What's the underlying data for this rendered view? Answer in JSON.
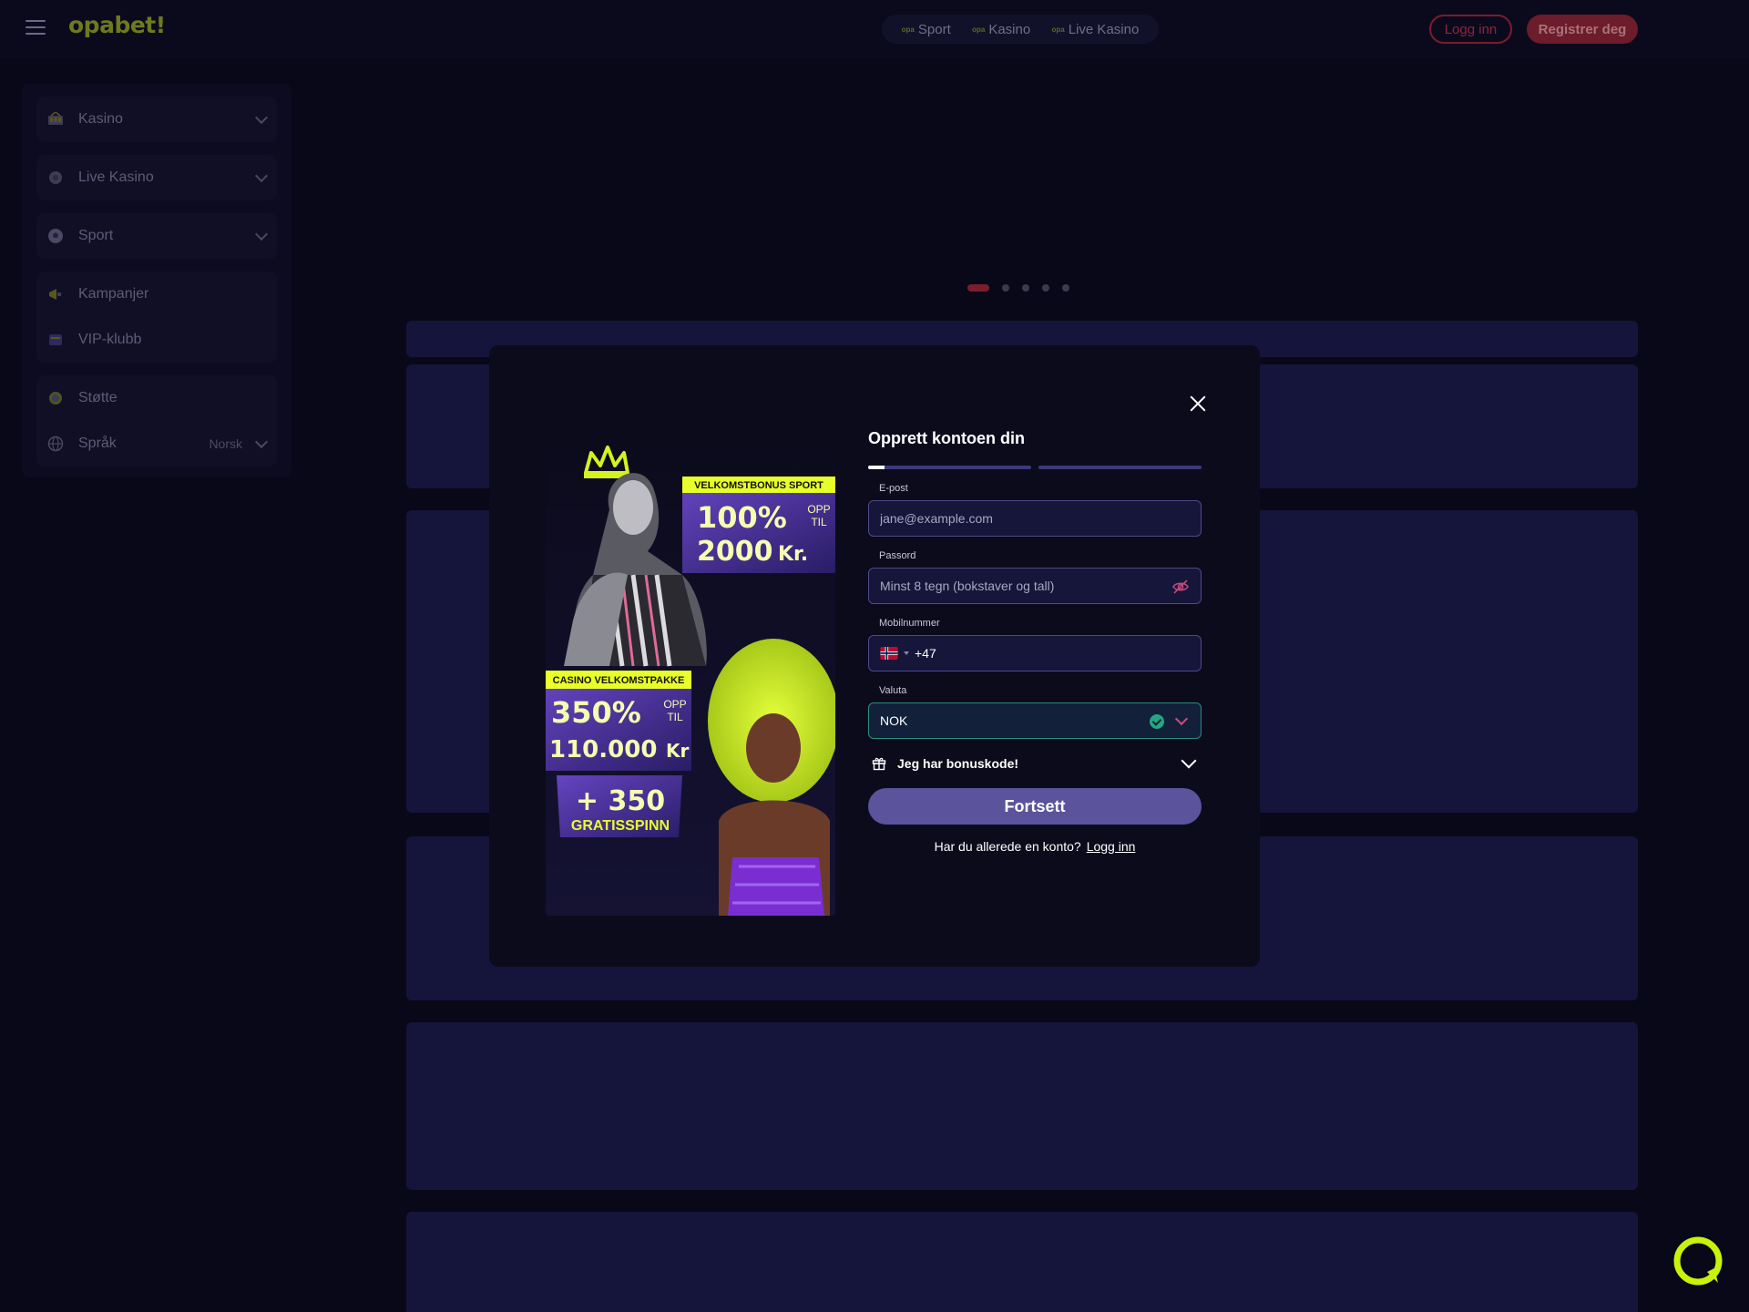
{
  "header": {
    "logo": "opabet!",
    "nav": [
      {
        "mini": "opa",
        "label": "Sport"
      },
      {
        "mini": "opa",
        "label": "Kasino"
      },
      {
        "mini": "opa",
        "label": "Live Kasino"
      }
    ],
    "login_label": "Logg inn",
    "register_label": "Registrer deg"
  },
  "sidebar": {
    "items": [
      {
        "label": "Kasino",
        "icon": "kasino-icon"
      },
      {
        "label": "Live Kasino",
        "icon": "live-kasino-icon"
      },
      {
        "label": "Sport",
        "icon": "sport-ball-icon"
      },
      {
        "label": "Kampanjer",
        "icon": "megaphone-icon"
      },
      {
        "label": "VIP-klubb",
        "icon": "vip-icon"
      },
      {
        "label": "Støtte",
        "icon": "support-icon"
      },
      {
        "label": "Språk",
        "icon": "globe-icon",
        "value": "Norsk"
      }
    ]
  },
  "carousel": {
    "slides": 5,
    "active": 1
  },
  "modal": {
    "title": "Opprett kontoen din",
    "progress": {
      "steps": 2,
      "step1_fill": 0.1
    },
    "promo": {
      "sport_badge": "VELKOMSTBONUS SPORT",
      "sport_pct": "100%",
      "sport_opp": "OPP",
      "sport_til": "TIL",
      "sport_amount": "2000",
      "sport_currency": "Kr.",
      "casino_badge": "CASINO VELKOMSTPAKKE",
      "casino_pct": "350%",
      "casino_opp": "OPP",
      "casino_til": "TIL",
      "casino_amount": "110.000",
      "casino_currency": "Kr",
      "spins_amount": "+ 350",
      "spins_label": "GRATISSPINN"
    },
    "email": {
      "label": "E-post",
      "placeholder": "jane@example.com"
    },
    "password": {
      "label": "Passord",
      "placeholder": "Minst 8 tegn (bokstaver og tall)"
    },
    "phone": {
      "label": "Mobilnummer",
      "prefix": "+47"
    },
    "currency": {
      "label": "Valuta",
      "value": "NOK"
    },
    "bonus_label": "Jeg har bonuskode!",
    "continue_label": "Fortsett",
    "have_account": "Har du allerede en konto?",
    "login_link": "Logg inn"
  },
  "colors": {
    "page_bg": "#090818",
    "brand_red": "#7a1d2d",
    "primary_button": "#5b539c",
    "input_border": "#4c4a8a",
    "valid_green": "#25a583",
    "chat_accent": "#c8f20a"
  }
}
